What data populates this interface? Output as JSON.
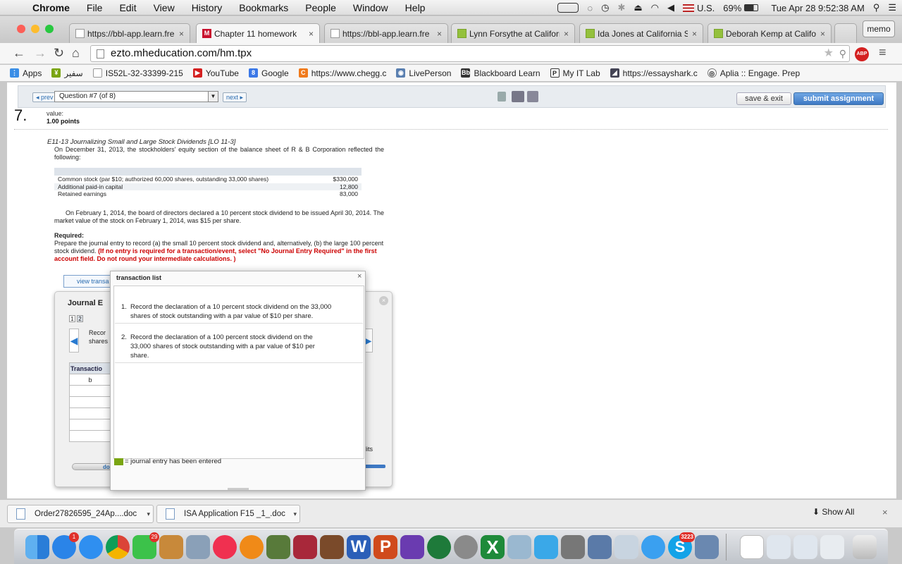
{
  "menubar": {
    "app": "Chrome",
    "items": [
      "File",
      "Edit",
      "View",
      "History",
      "Bookmarks",
      "People",
      "Window",
      "Help"
    ],
    "input_source": "U.S.",
    "battery": "69%",
    "clock": "Tue Apr 28  9:52:38 AM"
  },
  "tabs": [
    {
      "title": "https://bbl-app.learn.fre",
      "icon": "page-icon"
    },
    {
      "title": "Chapter 11 homework",
      "icon": "mheducation-icon"
    },
    {
      "title": "https://bbl-app.learn.fre",
      "icon": "page-icon"
    },
    {
      "title": "Lynn Forsythe at Califorr",
      "icon": "chat-icon"
    },
    {
      "title": "Ida Jones at California S",
      "icon": "chat-icon"
    },
    {
      "title": "Deborah Kemp at Califor",
      "icon": "chat-icon"
    }
  ],
  "tab_close": "×",
  "memo_label": "memo",
  "url": "ezto.mheducation.com/hm.tpx",
  "adblock_label": "ABP",
  "bookmarks": [
    {
      "label": "Apps",
      "icon": "apps-icon"
    },
    {
      "label": "سفیر",
      "icon": "bookmark-icon"
    },
    {
      "label": "IS52L-32-33399-215",
      "icon": "page-icon"
    },
    {
      "label": "YouTube",
      "icon": "youtube-icon"
    },
    {
      "label": "Google",
      "icon": "google-icon"
    },
    {
      "label": "https://www.chegg.c",
      "icon": "chegg-icon"
    },
    {
      "label": "LivePerson",
      "icon": "liveperson-icon"
    },
    {
      "label": "Blackboard Learn",
      "icon": "blackboard-icon"
    },
    {
      "label": "My IT Lab",
      "icon": "pearson-icon"
    },
    {
      "label": "https://essayshark.c",
      "icon": "shark-icon"
    },
    {
      "label": "Aplia :: Engage. Prep",
      "icon": "aplia-icon"
    }
  ],
  "question_bar": {
    "prev": "◂ prev",
    "selected_question": "Question #7 (of 8)",
    "next": "next ▸",
    "save_exit": "save & exit",
    "submit": "submit assignment"
  },
  "question": {
    "number": "7.",
    "value_label": "value:",
    "points": "1.00 points",
    "title": "E11-13 Journalizing Small and Large Stock Dividends [LO 11-3]",
    "intro": "On December 31, 2013, the stockholders' equity section of the balance sheet of R & B Corporation reflected the following:",
    "balance_rows": [
      {
        "label": "Common stock (par $10; authorized 60,000 shares, outstanding 33,000 shares)",
        "amount": "$330,000"
      },
      {
        "label": "Additional paid-in capital",
        "amount": "12,800"
      },
      {
        "label": "Retained earnings",
        "amount": "83,000"
      }
    ],
    "para2": "On February 1, 2014, the board of directors declared a 10 percent stock dividend to be issued April 30, 2014. The market value of the stock on February 1, 2014, was $15 per share.",
    "required_label": "Required:",
    "required_text": "Prepare the journal entry to record (a) the small 10 percent stock dividend and, alternatively, (b) the large 100 percent stock dividend.",
    "required_red": "(If no entry is required for a transaction/event, select \"No Journal Entry Required\" in the first account field. Do not round your intermediate calculations. )"
  },
  "journal": {
    "view_transactions": "view transa",
    "title": "Journal E",
    "pages": [
      "1",
      "2"
    ],
    "record_text_1": "Recor",
    "record_text_2": "shares",
    "col_header": "Transactio",
    "row_value": "b",
    "dits_label": "dits",
    "done_label": "do"
  },
  "popup": {
    "title": "transaction list",
    "close": "×",
    "items": [
      {
        "num": "1.",
        "text": "Record the declaration of a 10 percent stock dividend on the 33,000 shares of stock outstanding with a par value of $10 per share."
      },
      {
        "num": "2.",
        "text": "Record the declaration of a 100 percent stock dividend on the 33,000 shares of stock outstanding with a par value of $10 per share."
      }
    ],
    "legend": "= journal entry has been entered"
  },
  "downloads": [
    {
      "name": "Order27826595_24Ap....doc"
    },
    {
      "name": "ISA Application F15 _1_.doc"
    }
  ],
  "show_all": "Show All",
  "downloads_close": "×",
  "dock": {
    "badges": {
      "app_store": "1",
      "facetime": "29",
      "skype": "3223"
    }
  },
  "colors": {
    "accent": "#3e79c4",
    "required_red": "#cc0000",
    "entered_green": "#7aa512"
  }
}
